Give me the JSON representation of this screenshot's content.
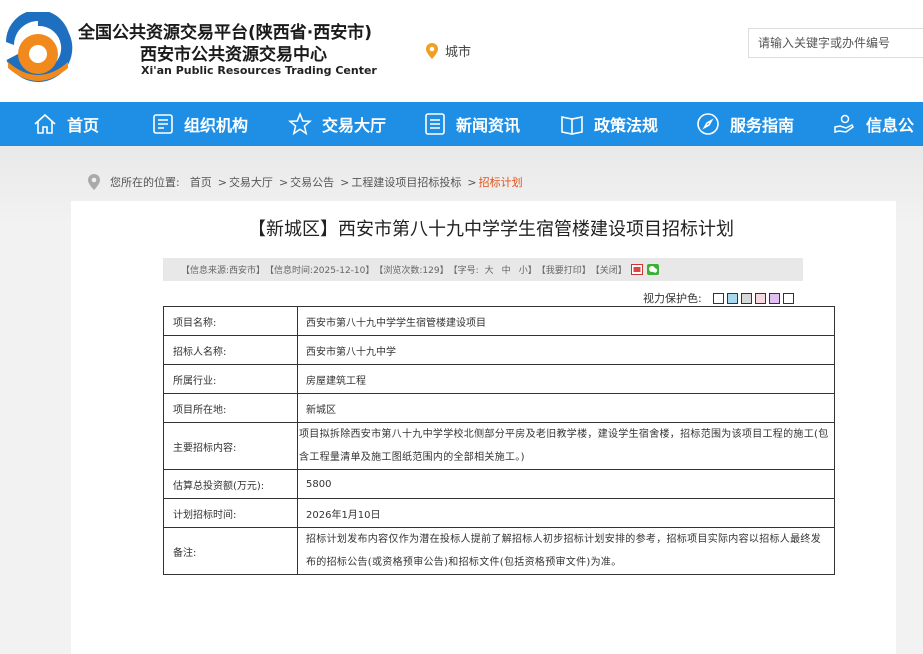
{
  "header": {
    "title": "全国公共资源交易平台(陕西省·西安市)",
    "subtitle": "西安市公共资源交易中心",
    "subtitle_en": "Xi'an Public Resources Trading Center",
    "city_label": "城市",
    "search_placeholder": "请输入关键字或办件编号"
  },
  "nav": {
    "items": [
      {
        "label": "首页",
        "icon": "home-icon"
      },
      {
        "label": "组织机构",
        "icon": "org-icon"
      },
      {
        "label": "交易大厅",
        "icon": "star-icon"
      },
      {
        "label": "新闻资讯",
        "icon": "news-icon"
      },
      {
        "label": "政策法规",
        "icon": "book-icon"
      },
      {
        "label": "服务指南",
        "icon": "compass-icon"
      },
      {
        "label": "信息公",
        "icon": "hand-icon"
      }
    ]
  },
  "breadcrumb": {
    "prefix": "您所在的位置:",
    "items": [
      "首页",
      "交易大厅",
      "交易公告",
      "工程建设项目招标投标"
    ],
    "current": "招标计划",
    "separator": ">"
  },
  "article": {
    "title": "【新城区】西安市第八十九中学学生宿管楼建设项目招标计划",
    "info": {
      "source": "【信息来源:西安市】",
      "time": "【信息时间:2025-12-10】",
      "views": "【浏览次数:129】",
      "fontsize_prefix": "【字号:",
      "size_large": "大",
      "size_medium": "中",
      "size_small": "小",
      "fontsize_suffix": "】",
      "print": "【我要打印】",
      "close": "【关闭】"
    },
    "eye_protection_label": "视力保护色:",
    "eye_colors": [
      "#ffffff",
      "#a8d8f0",
      "#d8d8d8",
      "#f8d8e0",
      "#e0c0f0",
      "#ffffff"
    ],
    "table": [
      {
        "key": "项目名称:",
        "value": "西安市第八十九中学学生宿管楼建设项目"
      },
      {
        "key": "招标人名称:",
        "value": "西安市第八十九中学"
      },
      {
        "key": "所属行业:",
        "value": "房屋建筑工程"
      },
      {
        "key": "项目所在地:",
        "value": "新城区"
      },
      {
        "key": "主要招标内容:",
        "value": "项目拟拆除西安市第八十九中学学校北侧部分平房及老旧教学楼，建设学生宿舍楼，招标范围为该项目工程的施工(包含工程量清单及施工图纸范围内的全部相关施工。)"
      },
      {
        "key": "估算总投资额(万元):",
        "value": "5800"
      },
      {
        "key": "计划招标时间:",
        "value": "2026年1月10日"
      },
      {
        "key": "备注:",
        "value": "招标计划发布内容仅作为潜在投标人提前了解招标人初步招标计划安排的参考，招标项目实际内容以招标人最终发布的招标公告(或资格预审公告)和招标文件(包括资格预审文件)为准。"
      }
    ]
  },
  "colors": {
    "nav_bg": "#1e8fe5",
    "logo_orange": "#f08a1c",
    "logo_blue": "#1e6fbf",
    "breadcrumb_current": "#e2541b"
  }
}
